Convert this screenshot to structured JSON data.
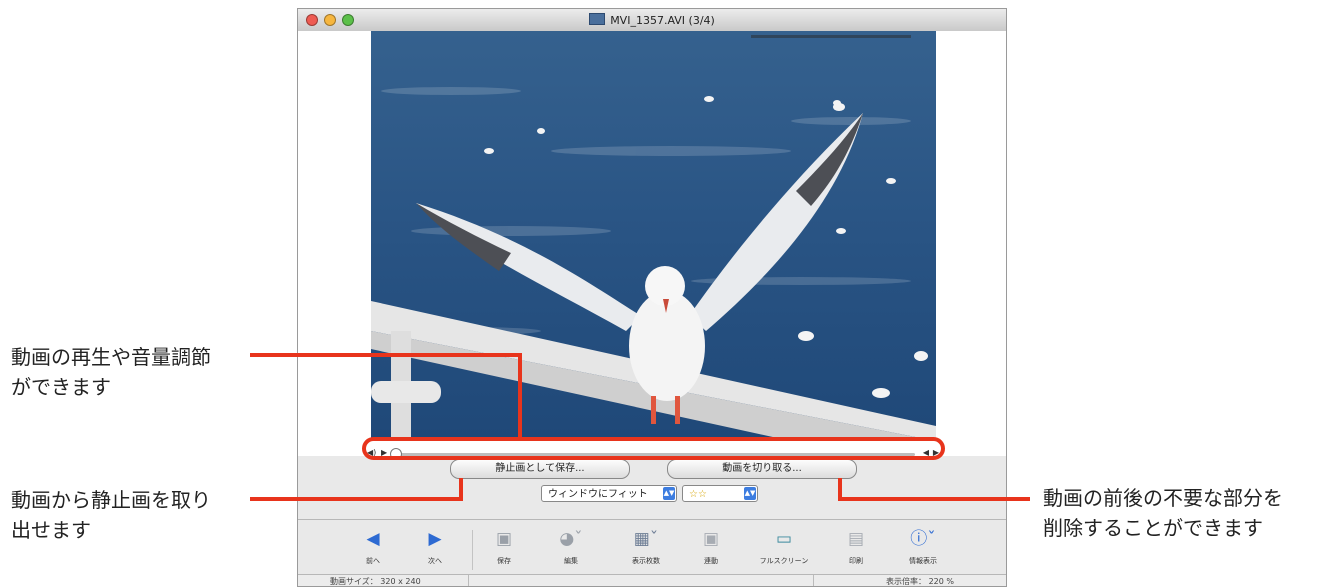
{
  "window": {
    "title": "MVI_1357.AVI (3/4)",
    "traffic_lights": {
      "close": "#ee5b52",
      "minimize": "#f6b63f",
      "zoom": "#5cc04a"
    }
  },
  "buttons": {
    "save_still": "静止画として保存...",
    "trim_movie": "動画を切り取る..."
  },
  "selects": {
    "fit": "ウィンドウにフィット",
    "rating": "☆☆"
  },
  "toolbar": {
    "items": [
      {
        "label": "前へ",
        "icon": "arrow-left-icon"
      },
      {
        "label": "次へ",
        "icon": "arrow-right-icon"
      },
      {
        "label": "保存",
        "icon": "save-icon"
      },
      {
        "label": "編集",
        "icon": "edit-icon"
      },
      {
        "label": "表示枚数",
        "icon": "view-count-icon"
      },
      {
        "label": "連動",
        "icon": "sync-icon"
      },
      {
        "label": "フルスクリーン",
        "icon": "fullscreen-icon"
      },
      {
        "label": "印刷",
        "icon": "print-icon"
      },
      {
        "label": "情報表示",
        "icon": "info-icon"
      }
    ]
  },
  "status": {
    "movie_size": "動画サイズ： 320 x 240",
    "zoom": "表示倍率： 220 %"
  },
  "callouts": {
    "playback_l1": "動画の再生や音量調節",
    "playback_l2": "ができます",
    "still_l1": "動画から静止画を取り",
    "still_l2": "出せます",
    "trim_l1": "動画の前後の不要な部分を",
    "trim_l2": "削除することができます"
  },
  "colors": {
    "accent": "#e8341c",
    "select_arrow": "#3d7de0"
  }
}
